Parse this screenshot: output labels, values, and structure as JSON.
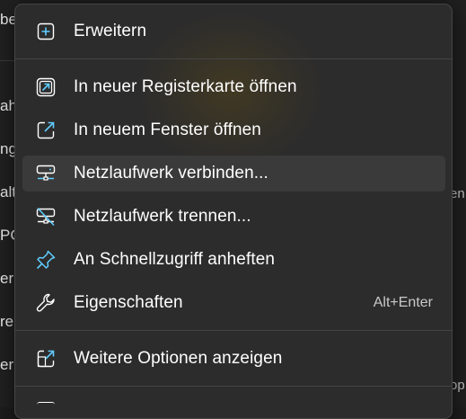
{
  "background": {
    "left_fragments": [
      "bei",
      "ahe",
      "ng",
      "altu",
      "PC",
      "er",
      "ren",
      "erk"
    ],
    "right_fragments": [
      "en",
      "op"
    ]
  },
  "menu": {
    "items": [
      {
        "label": "Erweitern",
        "icon": "expand-plus-icon",
        "shortcut": ""
      },
      {
        "label": "In neuer Registerkarte öffnen",
        "icon": "open-new-tab-icon",
        "shortcut": ""
      },
      {
        "label": "In neuem Fenster öffnen",
        "icon": "open-new-window-icon",
        "shortcut": ""
      },
      {
        "label": "Netzlaufwerk verbinden...",
        "icon": "map-network-drive-icon",
        "shortcut": ""
      },
      {
        "label": "Netzlaufwerk trennen...",
        "icon": "disconnect-network-drive-icon",
        "shortcut": ""
      },
      {
        "label": "An Schnellzugriff anheften",
        "icon": "pin-icon",
        "shortcut": ""
      },
      {
        "label": "Eigenschaften",
        "icon": "wrench-icon",
        "shortcut": "Alt+Enter"
      },
      {
        "label": "Weitere Optionen anzeigen",
        "icon": "more-options-icon",
        "shortcut": ""
      }
    ],
    "hovered_item": "Netzlaufwerk verbinden...",
    "colors": {
      "accent": "#60cdff",
      "menu_bg": "#2c2c2c",
      "hover_bg": "#3a3a3a"
    }
  }
}
